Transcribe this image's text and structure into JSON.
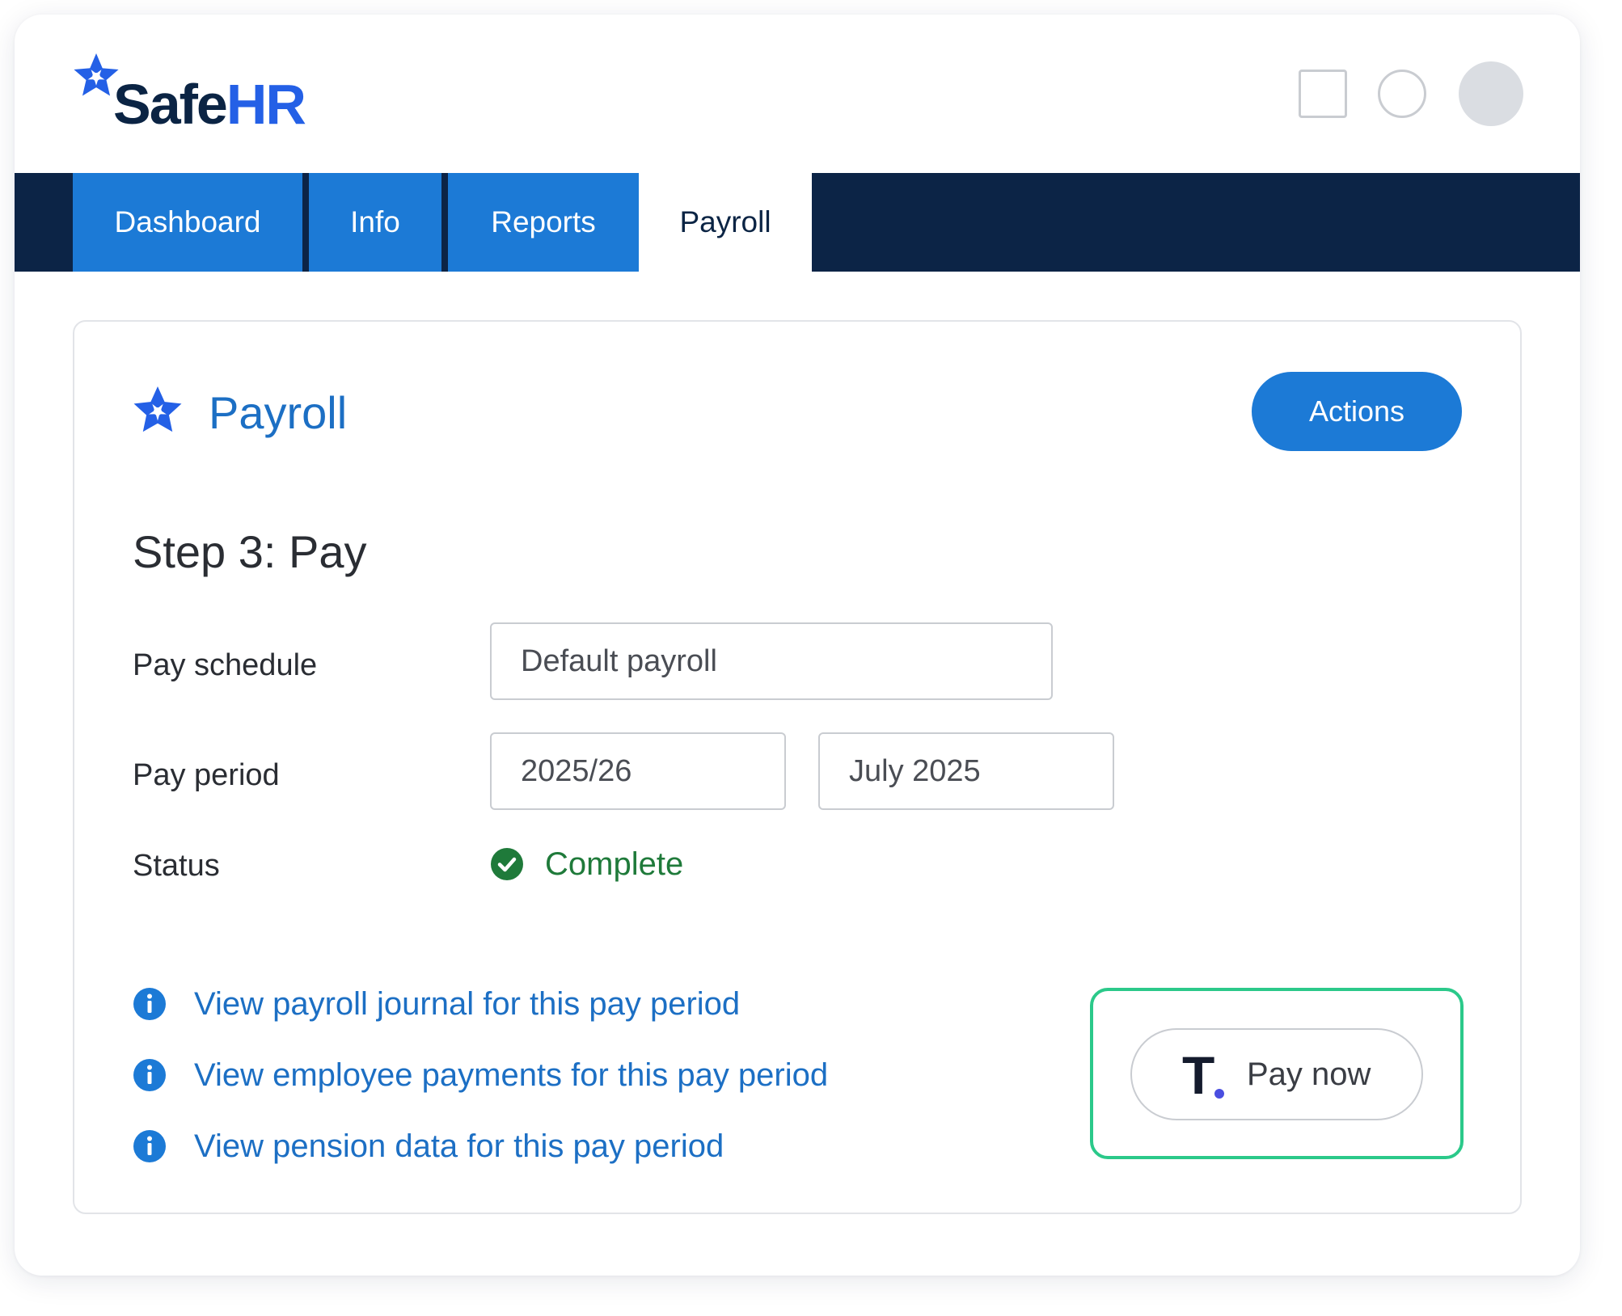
{
  "brand": {
    "name_part1": "Safe",
    "name_part2": "HR",
    "colors": {
      "navy": "#0c2446",
      "primary_blue": "#1c7ad6",
      "logo_blue": "#2460e6",
      "success_green": "#1f7a3a",
      "highlight_green": "#2bc98a"
    }
  },
  "header": {
    "icons": [
      "square-icon",
      "circle-icon",
      "avatar"
    ]
  },
  "nav": {
    "tabs": [
      {
        "label": "Dashboard",
        "active": false
      },
      {
        "label": "Info",
        "active": false
      },
      {
        "label": "Reports",
        "active": false
      },
      {
        "label": "Payroll",
        "active": true
      }
    ]
  },
  "card": {
    "title": "Payroll",
    "icon": "asterisk-logo-icon",
    "actions_label": "Actions",
    "step_title": "Step 3: Pay",
    "form": {
      "pay_schedule_label": "Pay schedule",
      "pay_schedule_value": "Default payroll",
      "pay_period_label": "Pay period",
      "pay_period_year": "2025/26",
      "pay_period_month": "July 2025",
      "status_label": "Status",
      "status_value": "Complete",
      "status_icon": "check-circle-icon"
    },
    "links": [
      {
        "label": "View payroll journal for this pay period",
        "icon": "info-icon"
      },
      {
        "label": "View employee payments for this pay period",
        "icon": "info-icon"
      },
      {
        "label": "View pension data for this pay period",
        "icon": "info-icon"
      }
    ],
    "pay_now": {
      "logo_letter": "T",
      "label": "Pay now"
    }
  }
}
